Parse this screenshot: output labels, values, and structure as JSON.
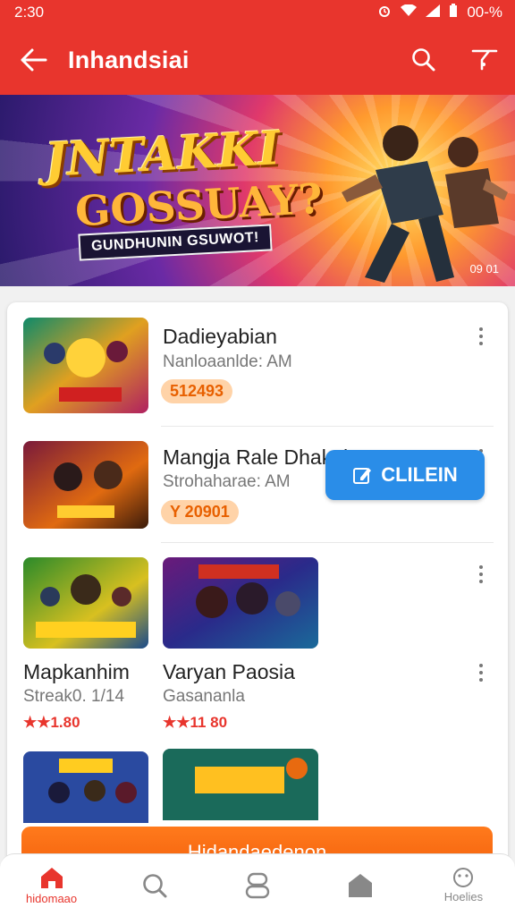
{
  "status": {
    "time": "2:30",
    "battery": "00-%"
  },
  "appbar": {
    "title": "Inhandsiai"
  },
  "banner": {
    "line1": "JNTAKKI",
    "line2": "GOSSUAY?",
    "subtitle": "GUNDHUNIN GSUWOT!",
    "page": "09 01"
  },
  "items": [
    {
      "name": "Dadieyabian",
      "subtitle": "Nanloaanlde: AM",
      "price": "512493"
    },
    {
      "name": "Mangja Rale Dhakaha",
      "subtitle": "Strohaharae: AM",
      "price": "Y 20901"
    }
  ],
  "grid_items": [
    {
      "name": "Mapkanhim",
      "subtitle": "Streak0. 1/14",
      "rating": "★★1.80"
    },
    {
      "name": "Varyan Paosia",
      "subtitle": "Gasananla",
      "rating": "★★11 80"
    }
  ],
  "cta": {
    "label": "CLILEIN"
  },
  "orange_button": {
    "label": "Hidandaedenon"
  },
  "nav": {
    "home": "hidomaao",
    "profile": "Hoelies"
  },
  "colors": {
    "primary": "#e8352d",
    "accent_blue": "#2a8de8",
    "orange": "#f25d0a"
  }
}
